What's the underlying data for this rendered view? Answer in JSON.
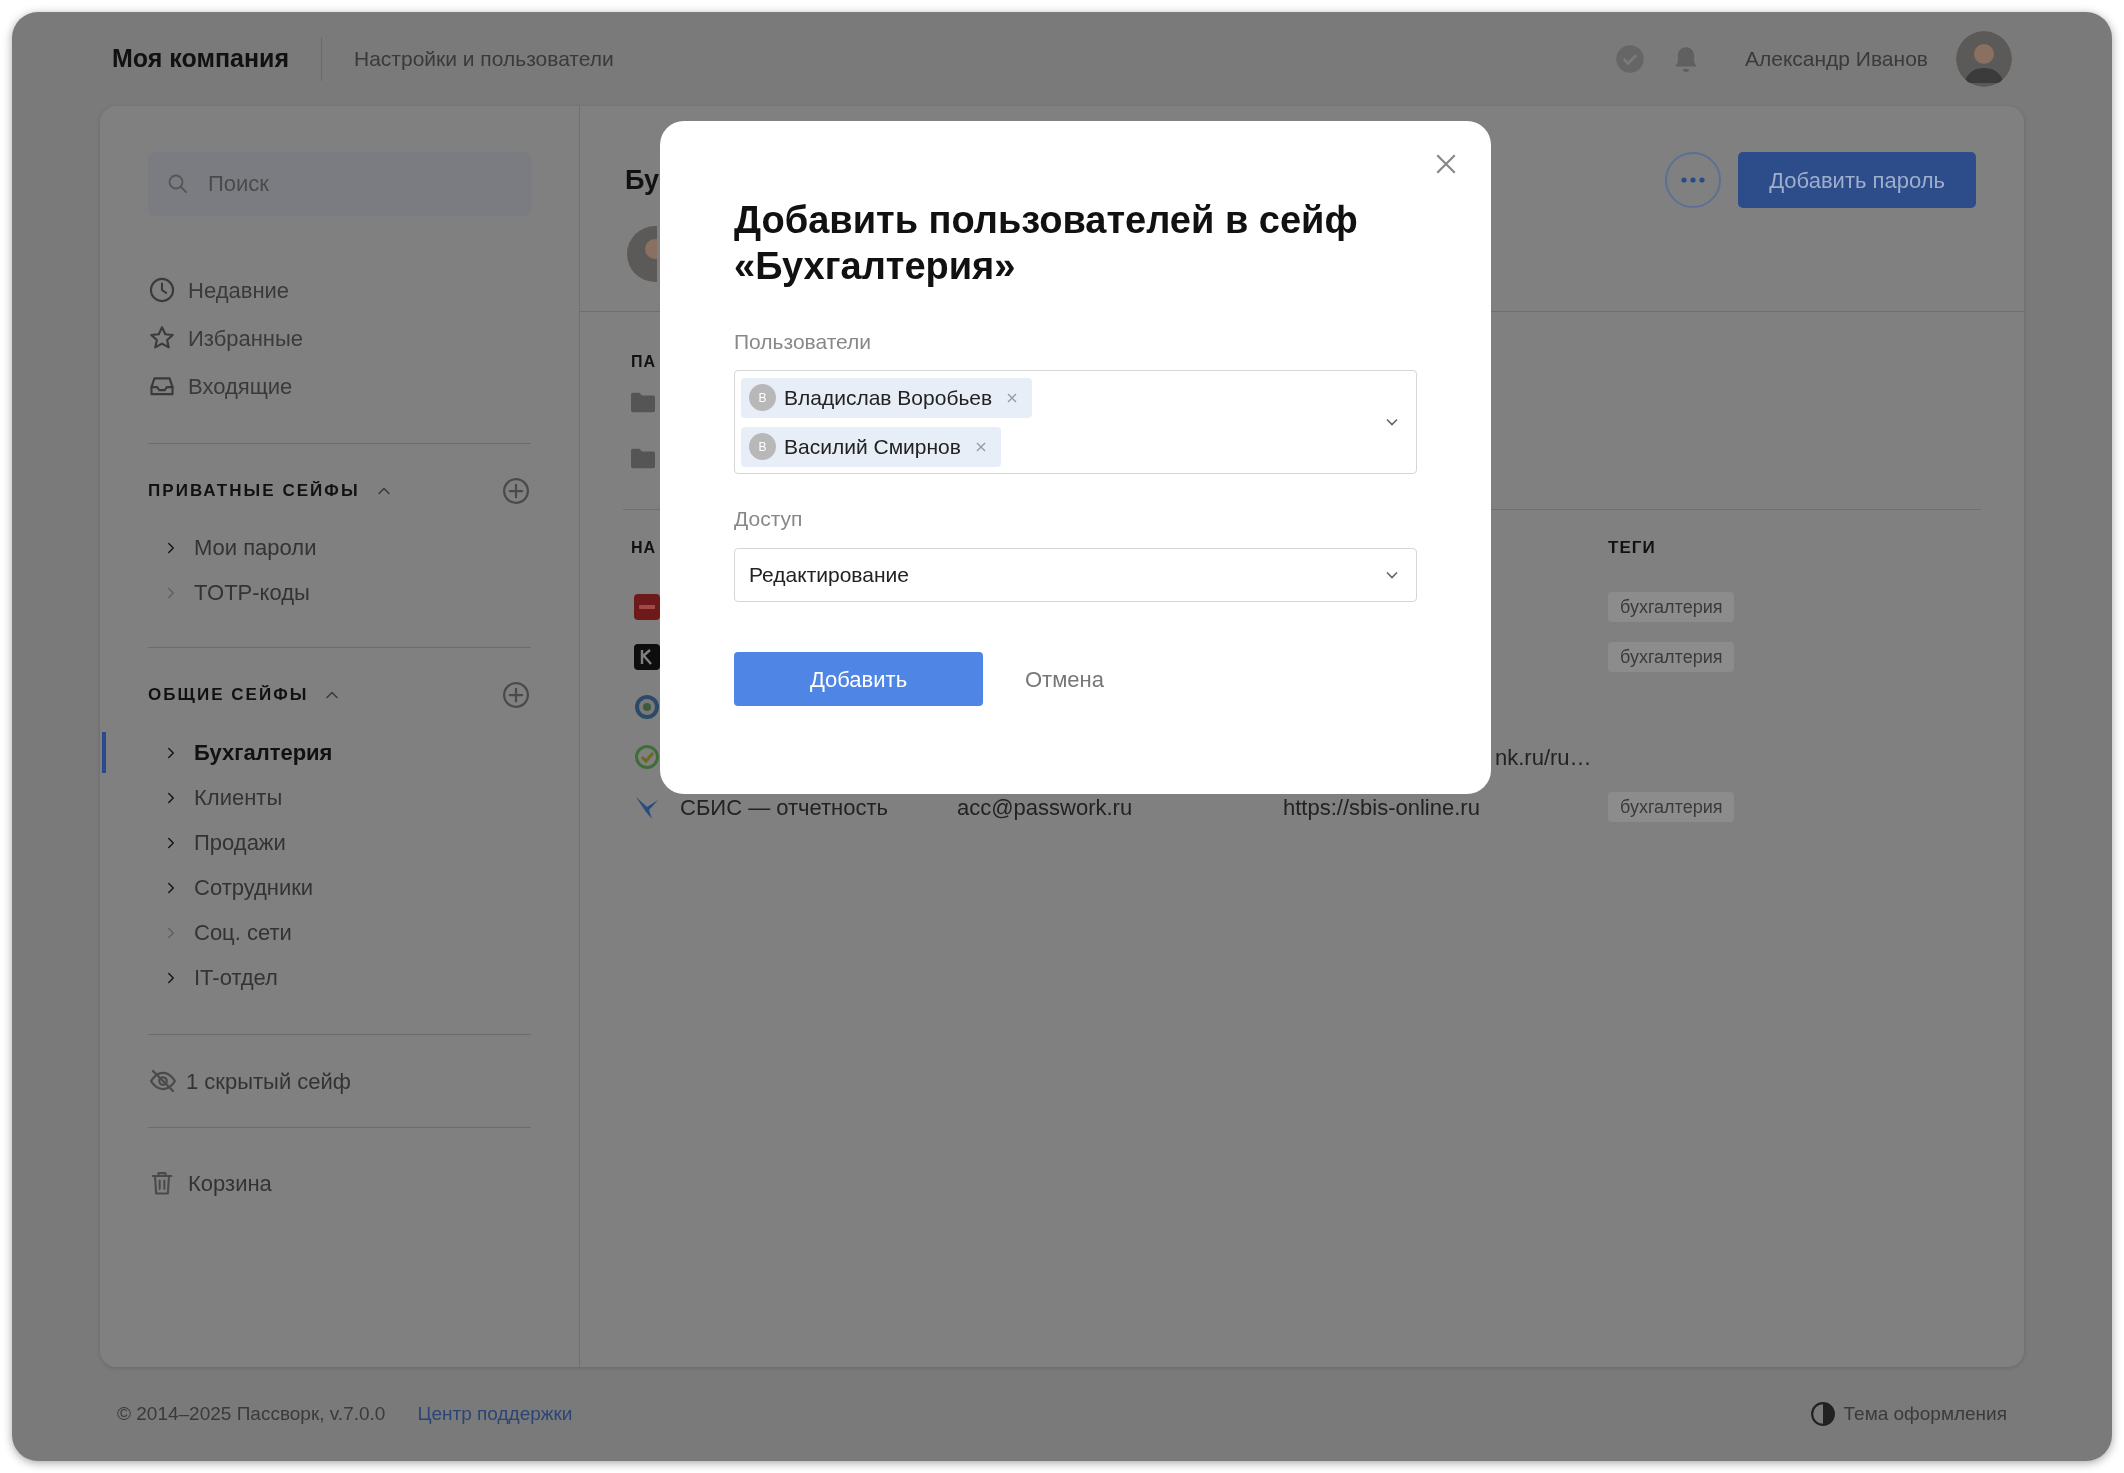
{
  "header": {
    "company": "Моя компания",
    "section": "Настройки и пользователи",
    "user": "Александр Иванов"
  },
  "sidebar": {
    "search": {
      "placeholder": "Поиск"
    },
    "nav": [
      {
        "kind": "recent",
        "label": "Недавние"
      },
      {
        "kind": "favorites",
        "label": "Избранные"
      },
      {
        "kind": "inbox",
        "label": "Входящие"
      }
    ],
    "groups": [
      {
        "title": "ПРИВАТНЫЕ СЕЙФЫ",
        "expanded": true,
        "items": [
          {
            "label": "Мои пароли",
            "selected": false,
            "has_children": true
          },
          {
            "label": "TOTP-коды",
            "selected": false,
            "has_children": false
          }
        ]
      },
      {
        "title": "ОБЩИЕ СЕЙФЫ",
        "expanded": true,
        "items": [
          {
            "label": "Бухгалтерия",
            "selected": true,
            "has_children": true
          },
          {
            "label": "Клиенты",
            "selected": false,
            "has_children": true
          },
          {
            "label": "Продажи",
            "selected": false,
            "has_children": true
          },
          {
            "label": "Сотрудники",
            "selected": false,
            "has_children": true
          },
          {
            "label": "Соц. сети",
            "selected": false,
            "has_children": false
          },
          {
            "label": "IT-отдел",
            "selected": false,
            "has_children": true
          }
        ]
      }
    ],
    "hidden": "1 скрытый сейф",
    "trash": "Корзина"
  },
  "content": {
    "title": "Бу",
    "add_button": "Добавить пароль",
    "section_label": "ПА",
    "folders": [
      {
        "kind": "folder"
      },
      {
        "kind": "folder"
      }
    ],
    "table": {
      "columns": [
        "НА",
        "ТЕГИ"
      ],
      "rows": [
        {
          "tags": [
            "бухгалтерия"
          ]
        },
        {
          "tags": [
            "бухгалтерия"
          ]
        },
        {
          "tags": []
        },
        {
          "url_tail": "nk.ru/ru…"
        },
        {
          "name": "СБИС — отчетность",
          "login": "acc@passwork.ru",
          "url": "https://sbis-online.ru",
          "tags": [
            "бухгалтерия"
          ]
        }
      ]
    }
  },
  "footer": {
    "copyright": "© 2014–2025 Пассворк, v.7.0.0",
    "support_link": "Центр поддержки",
    "theme": "Тема оформления"
  },
  "dialog": {
    "title": "Добавить пользователей в сейф «Бухгалтерия»",
    "users_label": "Пользователи",
    "users": [
      {
        "initial": "В",
        "name": "Владислав Воробьев"
      },
      {
        "initial": "В",
        "name": "Василий Смирнов"
      }
    ],
    "access_label": "Доступ",
    "access": "Редактирование",
    "submit": "Добавить",
    "cancel": "Отмена"
  }
}
